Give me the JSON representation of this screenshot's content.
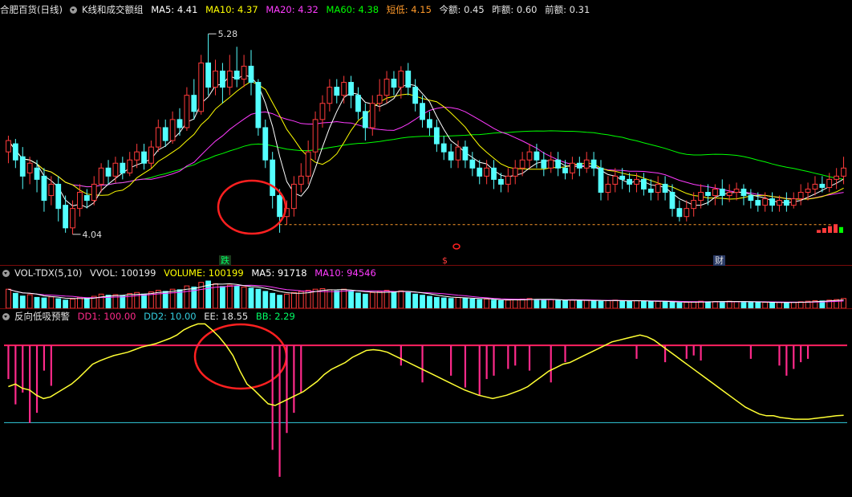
{
  "colors": {
    "up": "#ff3b3b",
    "down": "#54ffff",
    "ma5": "#ffffff",
    "ma10": "#ffff00",
    "ma20": "#ff3bff",
    "ma60": "#00ff00",
    "dd1": "#ff2a8a",
    "ee": "#ffff33",
    "ref_line": "#ff2060",
    "low_line": "#33ccdd"
  },
  "header_main": {
    "title": "合肥百货(日线)",
    "indicator": "K线和成交额组",
    "ma5": "MA5: 4.41",
    "ma10": "MA10: 4.37",
    "ma20": "MA20: 4.32",
    "ma60": "MA60: 4.38",
    "short_low": "短低: 4.15",
    "today_amt": "今额: 0.45",
    "yest_amt": "昨额: 0.60",
    "prev_amt": "前额: 0.31"
  },
  "header_vol": {
    "name": "VOL-TDX(5,10)",
    "vvol": "VVOL: 100199",
    "volume": "VOLUME: 100199",
    "ma5": "MA5: 91718",
    "ma10": "MA10: 94546"
  },
  "header_alert": {
    "name": "反向低吸预警",
    "dd1": "DD1: 100.00",
    "dd2": "DD2: 10.00",
    "ee": "EE: 18.55",
    "bb": "BB: 2.29"
  },
  "annotations": {
    "high_price": "5.28",
    "low_price": "4.04",
    "tag_drop": "跌",
    "tag_s": "$",
    "tag_fin": "财"
  },
  "chart_data": [
    {
      "type": "candlestick",
      "title": "K线和成交额组",
      "ylim": [
        3.95,
        5.38
      ],
      "high_label": 5.28,
      "low_label": 4.04,
      "candles": [
        [
          4.55,
          4.62,
          4.65,
          4.48
        ],
        [
          4.6,
          4.5,
          4.63,
          4.45
        ],
        [
          4.52,
          4.4,
          4.58,
          4.32
        ],
        [
          4.42,
          4.48,
          4.52,
          4.35
        ],
        [
          4.45,
          4.38,
          4.5,
          4.3
        ],
        [
          4.4,
          4.25,
          4.45,
          4.18
        ],
        [
          4.28,
          4.35,
          4.4,
          4.22
        ],
        [
          4.35,
          4.2,
          4.4,
          4.12
        ],
        [
          4.22,
          4.08,
          4.28,
          4.05
        ],
        [
          4.08,
          4.2,
          4.25,
          4.04
        ],
        [
          4.2,
          4.3,
          4.35,
          4.15
        ],
        [
          4.28,
          4.25,
          4.32,
          4.2
        ],
        [
          4.25,
          4.35,
          4.4,
          4.22
        ],
        [
          4.35,
          4.45,
          4.48,
          4.3
        ],
        [
          4.45,
          4.4,
          4.5,
          4.35
        ],
        [
          4.4,
          4.48,
          4.52,
          4.36
        ],
        [
          4.48,
          4.42,
          4.52,
          4.38
        ],
        [
          4.42,
          4.5,
          4.55,
          4.4
        ],
        [
          4.5,
          4.55,
          4.6,
          4.45
        ],
        [
          4.55,
          4.48,
          4.6,
          4.44
        ],
        [
          4.48,
          4.58,
          4.62,
          4.45
        ],
        [
          4.58,
          4.7,
          4.75,
          4.55
        ],
        [
          4.7,
          4.62,
          4.75,
          4.58
        ],
        [
          4.62,
          4.75,
          4.8,
          4.6
        ],
        [
          4.75,
          4.7,
          4.82,
          4.65
        ],
        [
          4.7,
          4.9,
          4.95,
          4.68
        ],
        [
          4.9,
          4.8,
          5.0,
          4.75
        ],
        [
          4.8,
          5.1,
          5.15,
          4.78
        ],
        [
          5.1,
          4.95,
          5.28,
          4.9
        ],
        [
          4.95,
          5.05,
          5.12,
          4.9
        ],
        [
          5.05,
          4.95,
          5.1,
          4.85
        ],
        [
          4.95,
          5.05,
          5.15,
          4.9
        ],
        [
          5.05,
          5.0,
          5.2,
          4.95
        ],
        [
          5.0,
          5.08,
          5.15,
          4.95
        ],
        [
          5.08,
          4.98,
          5.18,
          4.9
        ],
        [
          4.98,
          4.7,
          5.0,
          4.65
        ],
        [
          4.7,
          4.5,
          4.75,
          4.45
        ],
        [
          4.5,
          4.28,
          4.55,
          4.2
        ],
        [
          4.28,
          4.15,
          4.32,
          4.05
        ],
        [
          4.15,
          4.2,
          4.25,
          4.1
        ],
        [
          4.2,
          4.35,
          4.4,
          4.15
        ],
        [
          4.35,
          4.4,
          4.48,
          4.3
        ],
        [
          4.4,
          4.55,
          4.62,
          4.35
        ],
        [
          4.55,
          4.75,
          4.8,
          4.5
        ],
        [
          4.75,
          4.85,
          4.9,
          4.7
        ],
        [
          4.85,
          4.95,
          5.0,
          4.8
        ],
        [
          4.95,
          4.9,
          5.0,
          4.85
        ],
        [
          4.9,
          4.98,
          5.02,
          4.85
        ],
        [
          4.98,
          4.9,
          5.02,
          4.82
        ],
        [
          4.9,
          4.8,
          4.95,
          4.75
        ],
        [
          4.8,
          4.7,
          4.85,
          4.62
        ],
        [
          4.7,
          4.85,
          4.9,
          4.65
        ],
        [
          4.85,
          4.9,
          5.0,
          4.8
        ],
        [
          4.9,
          5.0,
          5.05,
          4.85
        ],
        [
          5.0,
          4.95,
          5.05,
          4.9
        ],
        [
          4.95,
          5.05,
          5.08,
          4.88
        ],
        [
          5.05,
          4.95,
          5.1,
          4.9
        ],
        [
          4.95,
          4.85,
          5.0,
          4.8
        ],
        [
          4.85,
          4.75,
          4.9,
          4.7
        ],
        [
          4.75,
          4.7,
          4.8,
          4.65
        ],
        [
          4.7,
          4.6,
          4.75,
          4.55
        ],
        [
          4.6,
          4.55,
          4.65,
          4.5
        ],
        [
          4.55,
          4.5,
          4.6,
          4.45
        ],
        [
          4.5,
          4.58,
          4.62,
          4.45
        ],
        [
          4.58,
          4.5,
          4.62,
          4.45
        ],
        [
          4.5,
          4.45,
          4.55,
          4.4
        ],
        [
          4.45,
          4.4,
          4.5,
          4.35
        ],
        [
          4.4,
          4.45,
          4.5,
          4.35
        ],
        [
          4.45,
          4.38,
          4.5,
          4.32
        ],
        [
          4.38,
          4.35,
          4.42,
          4.3
        ],
        [
          4.35,
          4.4,
          4.45,
          4.3
        ],
        [
          4.4,
          4.45,
          4.5,
          4.35
        ],
        [
          4.45,
          4.5,
          4.55,
          4.4
        ],
        [
          4.5,
          4.55,
          4.6,
          4.45
        ],
        [
          4.55,
          4.5,
          4.6,
          4.45
        ],
        [
          4.5,
          4.45,
          4.55,
          4.4
        ],
        [
          4.45,
          4.5,
          4.55,
          4.42
        ],
        [
          4.5,
          4.45,
          4.55,
          4.4
        ],
        [
          4.45,
          4.42,
          4.5,
          4.38
        ],
        [
          4.42,
          4.48,
          4.52,
          4.38
        ],
        [
          4.48,
          4.45,
          4.52,
          4.4
        ],
        [
          4.45,
          4.5,
          4.55,
          4.42
        ],
        [
          4.5,
          4.45,
          4.55,
          4.4
        ],
        [
          4.45,
          4.3,
          4.5,
          4.25
        ],
        [
          4.3,
          4.35,
          4.4,
          4.25
        ],
        [
          4.35,
          4.4,
          4.45,
          4.3
        ],
        [
          4.4,
          4.38,
          4.45,
          4.32
        ],
        [
          4.38,
          4.35,
          4.42,
          4.3
        ],
        [
          4.35,
          4.38,
          4.42,
          4.3
        ],
        [
          4.38,
          4.32,
          4.42,
          4.28
        ],
        [
          4.32,
          4.3,
          4.38,
          4.25
        ],
        [
          4.3,
          4.35,
          4.4,
          4.25
        ],
        [
          4.35,
          4.3,
          4.4,
          4.25
        ],
        [
          4.3,
          4.2,
          4.35,
          4.15
        ],
        [
          4.2,
          4.15,
          4.25,
          4.12
        ],
        [
          4.15,
          4.2,
          4.25,
          4.12
        ],
        [
          4.2,
          4.25,
          4.3,
          4.15
        ],
        [
          4.25,
          4.3,
          4.35,
          4.2
        ],
        [
          4.3,
          4.28,
          4.35,
          4.22
        ],
        [
          4.28,
          4.32,
          4.35,
          4.22
        ],
        [
          4.32,
          4.28,
          4.38,
          4.22
        ],
        [
          4.28,
          4.3,
          4.35,
          4.24
        ],
        [
          4.3,
          4.32,
          4.36,
          4.25
        ],
        [
          4.32,
          4.28,
          4.35,
          4.22
        ],
        [
          4.28,
          4.25,
          4.32,
          4.2
        ],
        [
          4.25,
          4.22,
          4.3,
          4.18
        ],
        [
          4.22,
          4.26,
          4.3,
          4.18
        ],
        [
          4.26,
          4.22,
          4.3,
          4.18
        ],
        [
          4.22,
          4.25,
          4.28,
          4.18
        ],
        [
          4.25,
          4.22,
          4.3,
          4.18
        ],
        [
          4.22,
          4.26,
          4.3,
          4.2
        ],
        [
          4.26,
          4.3,
          4.35,
          4.22
        ],
        [
          4.3,
          4.32,
          4.36,
          4.25
        ],
        [
          4.32,
          4.35,
          4.4,
          4.28
        ],
        [
          4.35,
          4.33,
          4.4,
          4.3
        ],
        [
          4.33,
          4.38,
          4.42,
          4.3
        ],
        [
          4.38,
          4.4,
          4.45,
          4.32
        ],
        [
          4.4,
          4.45,
          4.52,
          4.35
        ]
      ],
      "ma_style": "smoothed close averages"
    },
    {
      "type": "bar",
      "title": "VOL-TDX(5,10)",
      "values": [
        70,
        55,
        45,
        50,
        40,
        38,
        42,
        35,
        30,
        34,
        40,
        38,
        44,
        52,
        48,
        50,
        46,
        54,
        58,
        52,
        60,
        66,
        62,
        70,
        68,
        82,
        78,
        95,
        100,
        90,
        80,
        85,
        82,
        78,
        74,
        70,
        62,
        55,
        48,
        52,
        58,
        62,
        66,
        70,
        72,
        68,
        64,
        70,
        62,
        56,
        52,
        58,
        62,
        66,
        60,
        64,
        58,
        52,
        48,
        44,
        40,
        38,
        36,
        40,
        38,
        34,
        32,
        34,
        30,
        28,
        30,
        32,
        34,
        36,
        32,
        30,
        32,
        30,
        28,
        30,
        28,
        30,
        28,
        26,
        28,
        30,
        28,
        26,
        28,
        26,
        24,
        26,
        24,
        22,
        20,
        22,
        24,
        26,
        24,
        25,
        24,
        26,
        25,
        24,
        22,
        21,
        22,
        21,
        22,
        21,
        22,
        24,
        26,
        28,
        27,
        30,
        32,
        36
      ],
      "ma5": 91718,
      "ma10": 94546
    },
    {
      "type": "line",
      "title": "反向低吸预警",
      "series": [
        {
          "name": "DD1",
          "values": [
            100
          ]
        },
        {
          "name": "DD2",
          "values": [
            10
          ]
        },
        {
          "name": "EE",
          "values": [
            52,
            55,
            50,
            48,
            42,
            38,
            40,
            45,
            50,
            55,
            62,
            70,
            78,
            82,
            85,
            88,
            90,
            92,
            95,
            98,
            100,
            102,
            105,
            108,
            112,
            118,
            122,
            125,
            125,
            118,
            110,
            100,
            88,
            70,
            55,
            48,
            40,
            32,
            30,
            34,
            38,
            42,
            46,
            52,
            58,
            66,
            72,
            76,
            80,
            86,
            90,
            94,
            95,
            94,
            92,
            88,
            84,
            80,
            76,
            72,
            68,
            64,
            60,
            56,
            52,
            48,
            45,
            42,
            40,
            38,
            40,
            42,
            45,
            48,
            52,
            58,
            64,
            70,
            74,
            78,
            80,
            84,
            88,
            92,
            96,
            100,
            104,
            106,
            108,
            110,
            112,
            110,
            106,
            100,
            94,
            88,
            82,
            76,
            70,
            64,
            58,
            52,
            46,
            40,
            34,
            28,
            24,
            20,
            18,
            18,
            16,
            15,
            14,
            14,
            14,
            15,
            16,
            17,
            18,
            18.55
          ]
        },
        {
          "name": "BB",
          "values": [
            2.29
          ]
        }
      ],
      "spikes": [
        {
          "i": 0,
          "v": 20
        },
        {
          "i": 1,
          "v": 35
        },
        {
          "i": 2,
          "v": 28
        },
        {
          "i": 3,
          "v": 46
        },
        {
          "i": 4,
          "v": 40
        },
        {
          "i": 5,
          "v": 15
        },
        {
          "i": 6,
          "v": 24
        },
        {
          "i": 37,
          "v": 62
        },
        {
          "i": 38,
          "v": 78
        },
        {
          "i": 39,
          "v": 52
        },
        {
          "i": 40,
          "v": 40
        },
        {
          "i": 41,
          "v": 28
        },
        {
          "i": 55,
          "v": 12
        },
        {
          "i": 58,
          "v": 22
        },
        {
          "i": 62,
          "v": 18
        },
        {
          "i": 64,
          "v": 25
        },
        {
          "i": 66,
          "v": 30
        },
        {
          "i": 67,
          "v": 20
        },
        {
          "i": 68,
          "v": 18
        },
        {
          "i": 70,
          "v": 14
        },
        {
          "i": 71,
          "v": 12
        },
        {
          "i": 73,
          "v": 15
        },
        {
          "i": 76,
          "v": 22
        },
        {
          "i": 78,
          "v": 10
        },
        {
          "i": 88,
          "v": 8
        },
        {
          "i": 92,
          "v": 10
        },
        {
          "i": 95,
          "v": 8
        },
        {
          "i": 96,
          "v": 6
        },
        {
          "i": 97,
          "v": 9
        },
        {
          "i": 104,
          "v": 8
        },
        {
          "i": 108,
          "v": 12
        },
        {
          "i": 109,
          "v": 18
        },
        {
          "i": 110,
          "v": 14
        },
        {
          "i": 111,
          "v": 10
        },
        {
          "i": 112,
          "v": 8
        },
        {
          "i": 119,
          "v": 12
        },
        {
          "i": 120,
          "v": 8
        },
        {
          "i": 125,
          "v": 12
        }
      ]
    }
  ]
}
